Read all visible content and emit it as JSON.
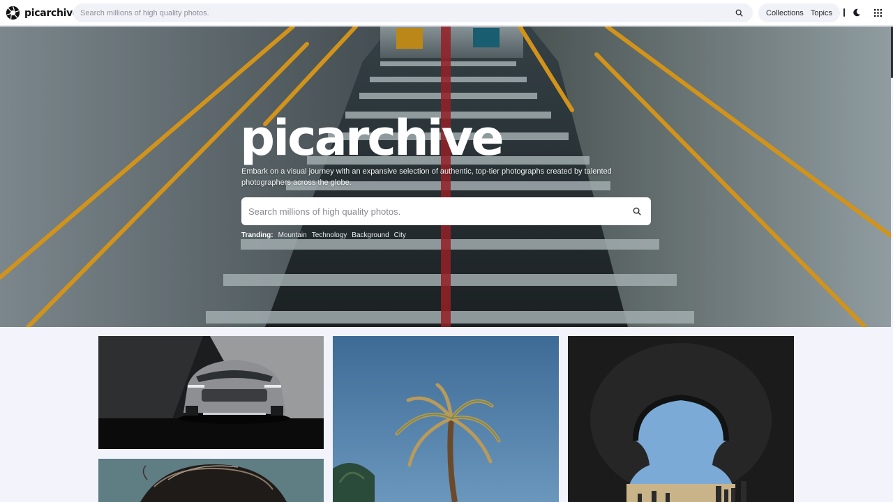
{
  "brand": {
    "name": "picarchive"
  },
  "header": {
    "search_placeholder": "Search millions of high quality photos.",
    "nav": [
      {
        "label": "Collections"
      },
      {
        "label": "Topics"
      }
    ],
    "icons": {
      "search": "search-icon",
      "theme": "moon-icon",
      "apps": "grid-icon"
    }
  },
  "hero": {
    "title": "picarchive",
    "subtitle": "Embark on a visual journey with an expansive selection of authentic, top-tier photographs created by talented photographers across the globe.",
    "search_placeholder": "Search millions of high quality photos.",
    "trending_label": "Tranding:",
    "trending": [
      "Mountain",
      "Technology",
      "Background",
      "City"
    ]
  },
  "colors": {
    "accent": "#f5a623",
    "page_background": "#f2f3fb",
    "header_background": "#ffffff"
  }
}
